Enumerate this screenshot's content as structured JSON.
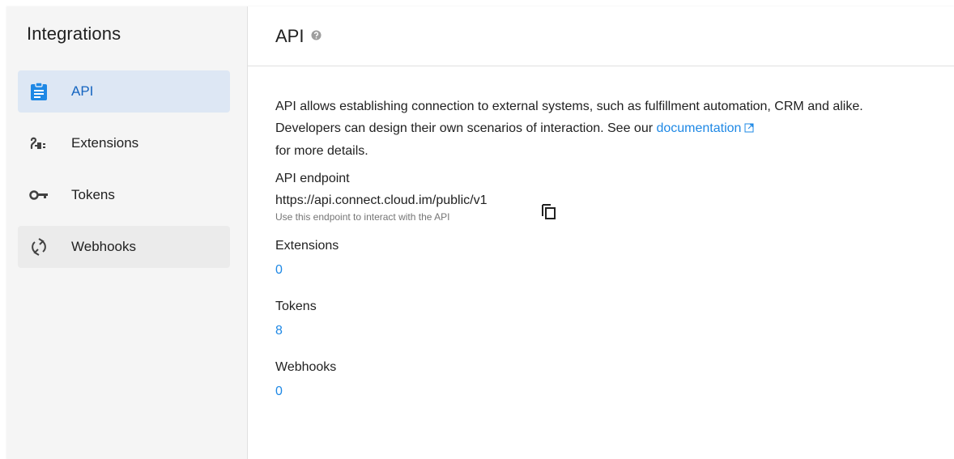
{
  "sidebar": {
    "title": "Integrations",
    "items": [
      {
        "label": "API",
        "icon": "clipboard-icon",
        "active": true
      },
      {
        "label": "Extensions",
        "icon": "plug-icon",
        "active": false
      },
      {
        "label": "Tokens",
        "icon": "key-icon",
        "active": false
      },
      {
        "label": "Webhooks",
        "icon": "sync-icon",
        "active": false
      }
    ]
  },
  "header": {
    "title": "API",
    "help_icon": "help-circle-icon"
  },
  "main": {
    "description_before_link": "API allows establishing connection to external systems, such as fulfillment automation, CRM and alike. Developers can design their own scenarios of interaction. See our ",
    "doc_link_label": "documentation",
    "description_after_link": "for more details.",
    "endpoint": {
      "label": "API endpoint",
      "url": "https://api.connect.cloud.im/public/v1",
      "hint": "Use this endpoint to interact with the API",
      "copy_icon": "copy-icon"
    },
    "counts": [
      {
        "label": "Extensions",
        "value": "0"
      },
      {
        "label": "Tokens",
        "value": "8"
      },
      {
        "label": "Webhooks",
        "value": "0"
      }
    ]
  },
  "colors": {
    "accent": "#1e88e5",
    "active_bg": "#dde7f4",
    "sidebar_bg": "#f5f5f5"
  }
}
